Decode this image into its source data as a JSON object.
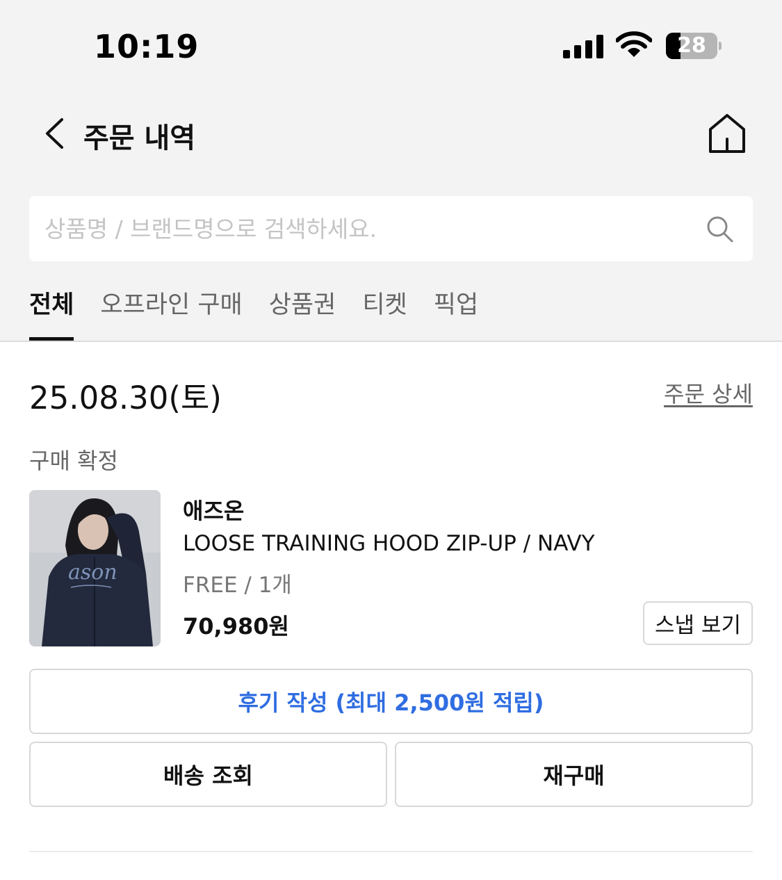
{
  "status_bar": {
    "time": "10:19",
    "battery_level": "28",
    "battery_fraction": 0.28
  },
  "header": {
    "title": "주문 내역",
    "back_icon": "chevron-left-icon",
    "home_icon": "home-icon"
  },
  "search": {
    "value": "",
    "placeholder": "상품명 / 브랜드명으로 검색하세요.",
    "icon": "search-icon"
  },
  "tabs": [
    {
      "label": "전체",
      "active": true
    },
    {
      "label": "오프라인 구매",
      "active": false
    },
    {
      "label": "상품권",
      "active": false
    },
    {
      "label": "티켓",
      "active": false
    },
    {
      "label": "픽업",
      "active": false
    }
  ],
  "order": {
    "date": "25.08.30(토)",
    "detail_link": "주문 상세",
    "status": "구매 확정",
    "item": {
      "brand": "애즈온",
      "name": "LOOSE TRAINING HOOD ZIP-UP / NAVY",
      "option": "FREE / 1개",
      "price": "70,980원",
      "snap_button": "스냅 보기",
      "image_print": "ason"
    },
    "review_button": "후기 작성 (최대 2,500원 적립)",
    "track_button": "배송 조회",
    "rebuy_button": "재구매"
  },
  "colors": {
    "accent_blue": "#2f6de1",
    "top_background": "#f3f3f3",
    "text_primary": "#111111",
    "text_secondary": "#666666"
  }
}
